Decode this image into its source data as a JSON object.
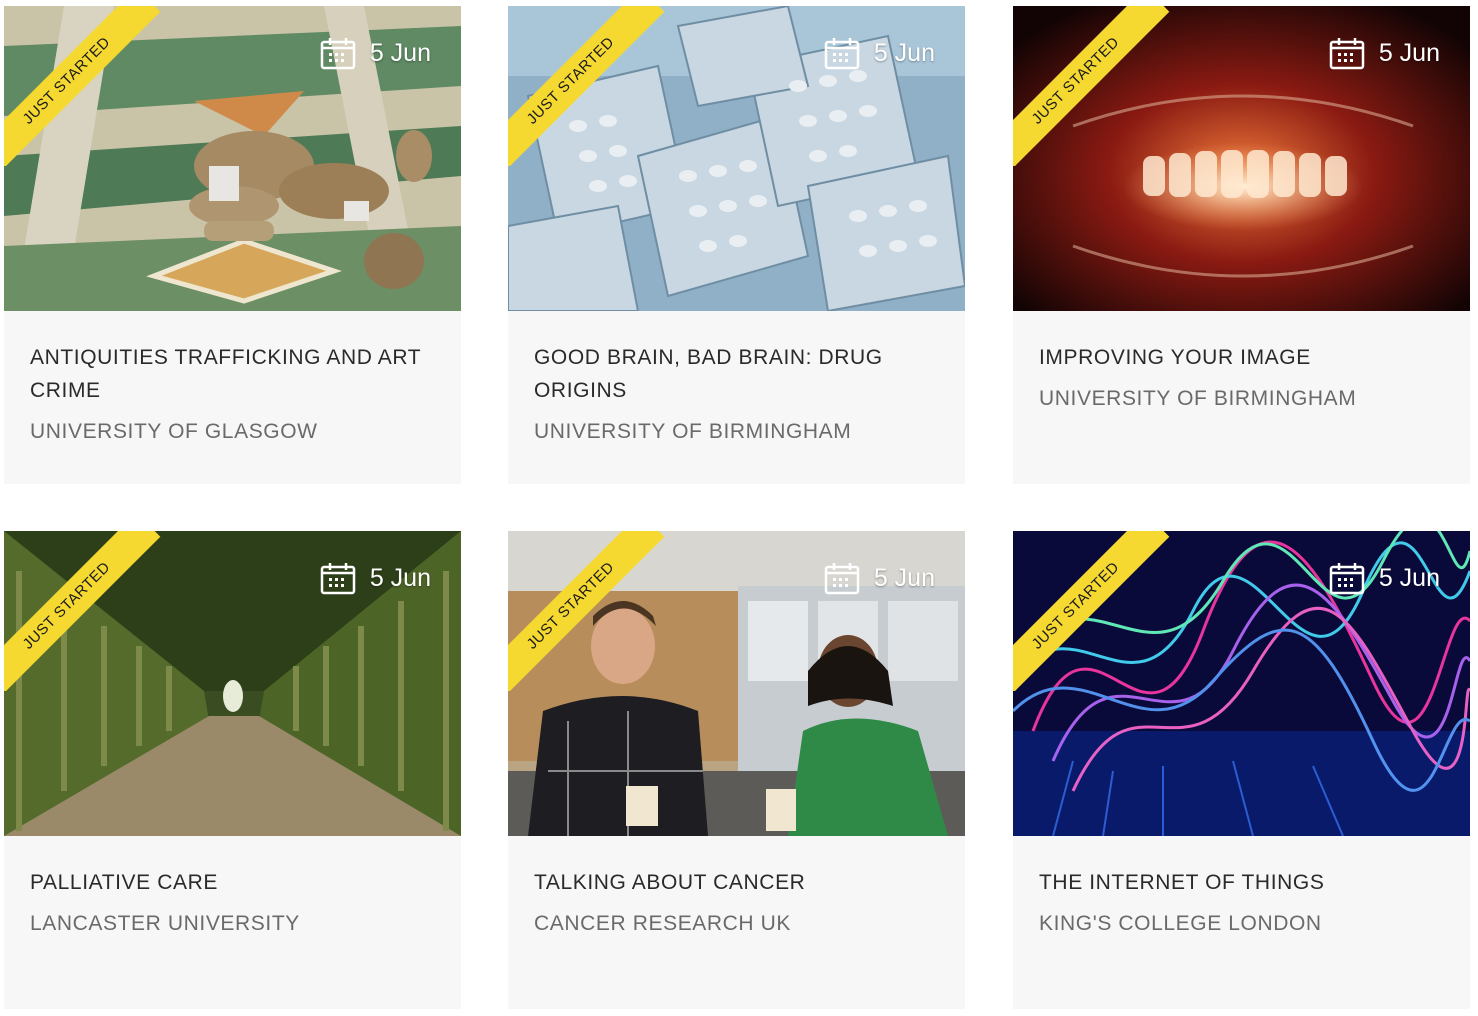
{
  "courses": [
    {
      "badge": "JUST STARTED",
      "date": "5 Jun",
      "title": "ANTIQUITIES TRAFFICKING AND ART CRIME",
      "organisation": "UNIVERSITY OF GLASGOW",
      "image": "broken-statue-on-mosaic-floor"
    },
    {
      "badge": "JUST STARTED",
      "date": "5 Jun",
      "title": "GOOD BRAIN, BAD BRAIN: DRUG ORIGINS",
      "organisation": "UNIVERSITY OF BIRMINGHAM",
      "image": "pill-blister-packs"
    },
    {
      "badge": "JUST STARTED",
      "date": "5 Jun",
      "title": "IMPROVING YOUR IMAGE",
      "organisation": "UNIVERSITY OF BIRMINGHAM",
      "image": "dental-x-ray"
    },
    {
      "badge": "JUST STARTED",
      "date": "5 Jun",
      "title": "PALLIATIVE CARE",
      "organisation": "LANCASTER UNIVERSITY",
      "image": "green-tunnel-arbour"
    },
    {
      "badge": "JUST STARTED",
      "date": "5 Jun",
      "title": "TALKING ABOUT CANCER",
      "organisation": "CANCER RESEARCH UK",
      "image": "two-people-talking-over-coffee"
    },
    {
      "badge": "JUST STARTED",
      "date": "5 Jun",
      "title": "THE INTERNET OF THINGS",
      "organisation": "KING'S COLLEGE LONDON",
      "image": "colourful-light-waves"
    }
  ],
  "colors": {
    "badge": "#f5d930",
    "card_background": "#f7f7f7",
    "title_text": "#2a2a2a",
    "organisation_text": "#6a6a6a"
  },
  "icons": [
    "calendar-icon"
  ]
}
